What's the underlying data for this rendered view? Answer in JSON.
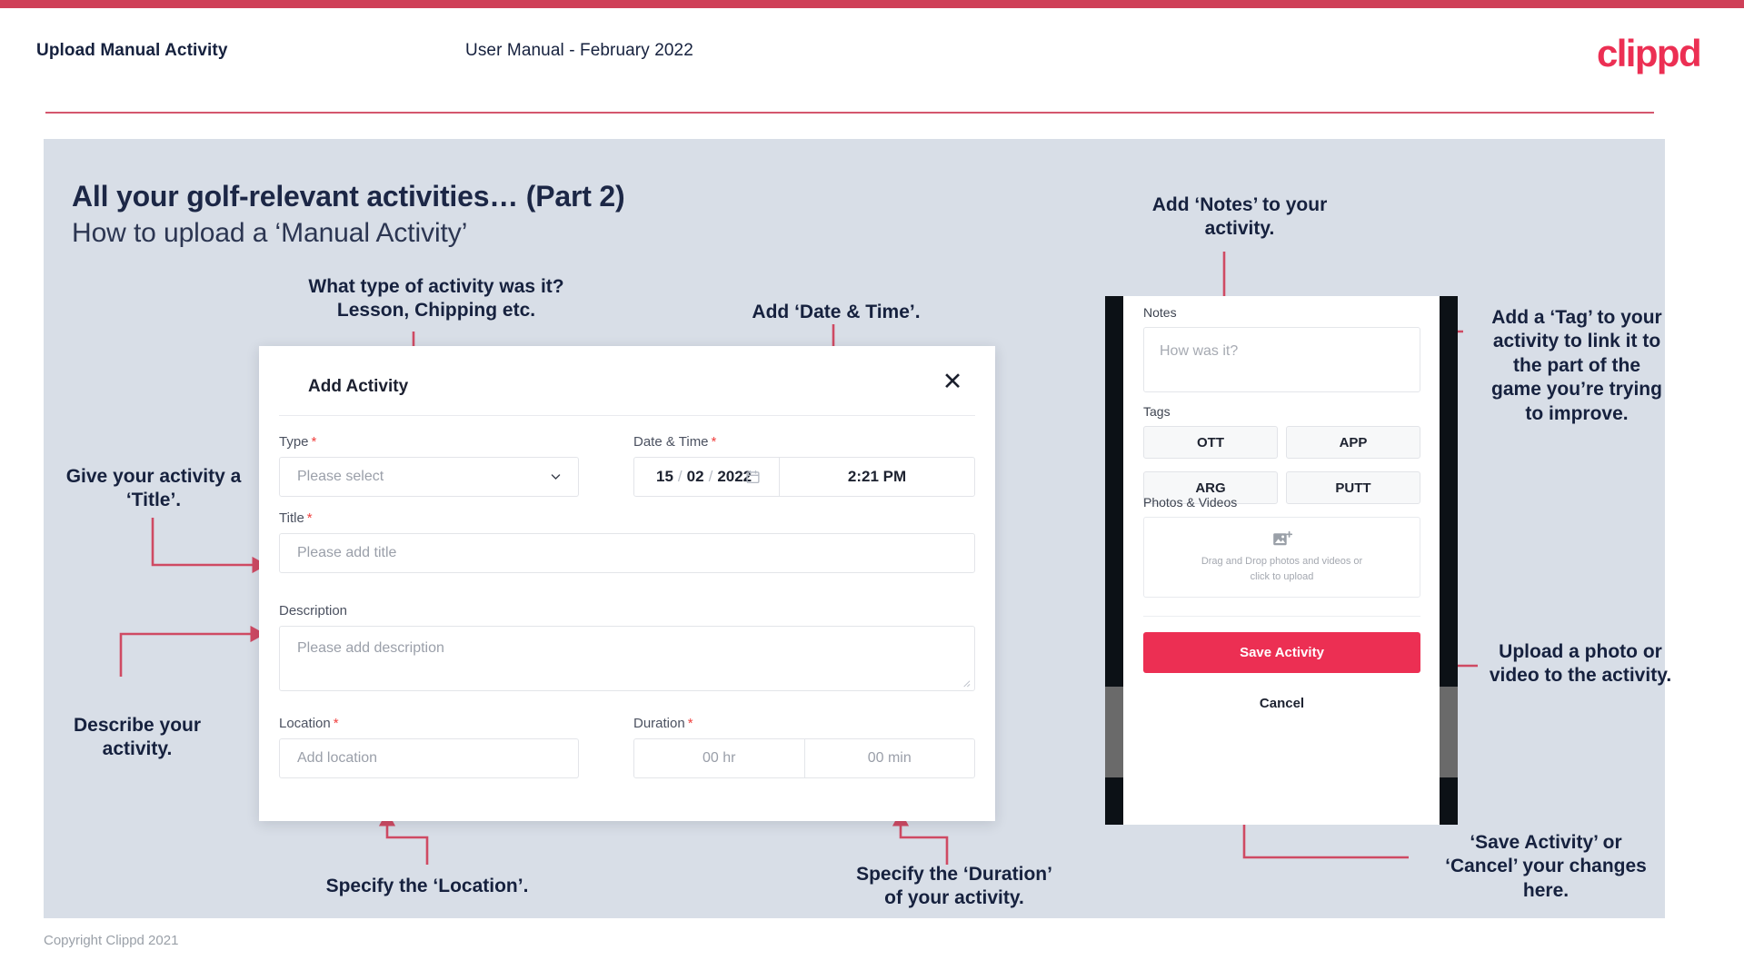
{
  "header": {
    "left_title": "Upload Manual Activity",
    "center_title": "User Manual - February 2022",
    "logo": "clippd"
  },
  "slide": {
    "title_line1": "All your golf-relevant activities… (Part 2)",
    "title_line2": "How to upload a ‘Manual Activity’",
    "footer": "Copyright Clippd 2021"
  },
  "colors": {
    "brand_pink": "#ec2f53",
    "top_bar": "#cf4058",
    "slide_bg": "#d8dee7",
    "annotation_text": "#16213e",
    "required_star": "#f0413f",
    "arrow": "#cf4a63"
  },
  "dialog": {
    "title": "Add Activity",
    "close_icon": "close-x-icon",
    "fields": {
      "type": {
        "label": "Type",
        "required": "*",
        "placeholder": "Please select",
        "icon": "chevron-down-icon"
      },
      "datetime": {
        "label": "Date & Time",
        "required": "*",
        "day": "15",
        "sep1": "/",
        "month": "02",
        "sep2": "/",
        "year": "2022",
        "icon": "calendar-icon",
        "time": "2:21 PM"
      },
      "title": {
        "label": "Title",
        "required": "*",
        "placeholder": "Please add title"
      },
      "description": {
        "label": "Description",
        "placeholder": "Please add description"
      },
      "location": {
        "label": "Location",
        "required": "*",
        "placeholder": "Add location"
      },
      "duration": {
        "label": "Duration",
        "required": "*",
        "hours_placeholder": "00 hr",
        "minutes_placeholder": "00 min"
      }
    }
  },
  "phone": {
    "notes": {
      "label": "Notes",
      "placeholder": "How was it?"
    },
    "tags": {
      "label": "Tags",
      "items": [
        "OTT",
        "APP",
        "ARG",
        "PUTT"
      ]
    },
    "photos": {
      "label": "Photos & Videos",
      "icon": "add-image-icon",
      "caption_line1": "Drag and Drop photos and videos or",
      "caption_line2": "click to upload"
    },
    "save_label": "Save Activity",
    "cancel_label": "Cancel"
  },
  "annotations": {
    "type": "What type of activity was it?\nLesson, Chipping etc.",
    "datetime": "Add ‘Date & Time’.",
    "title": "Give your activity a\n‘Title’.",
    "description": "Describe your\nactivity.",
    "location": "Specify the ‘Location’.",
    "duration": "Specify the ‘Duration’\nof your activity.",
    "notes": "Add ‘Notes’ to your\nactivity.",
    "tags": "Add a ‘Tag’ to your\nactivity to link it to\nthe part of the\ngame you’re trying\nto improve.",
    "photos": "Upload a photo or\nvideo to the activity.",
    "save_cancel": "‘Save Activity’ or\n‘Cancel’ your changes\nhere."
  }
}
